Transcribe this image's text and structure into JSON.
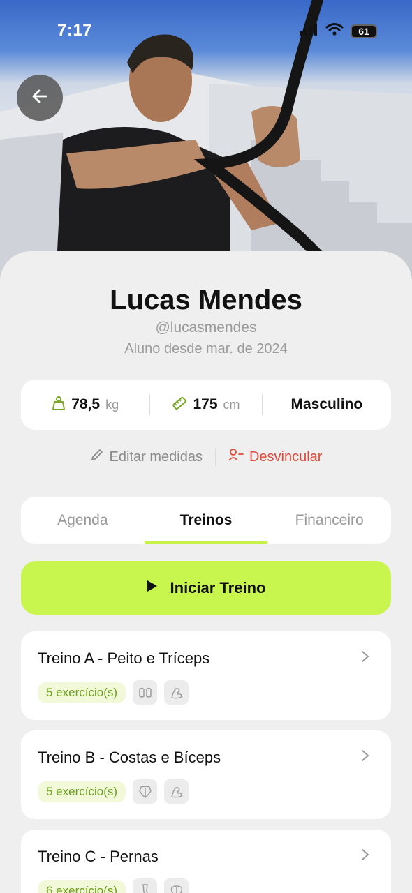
{
  "status_bar": {
    "time": "7:17",
    "battery": "61"
  },
  "profile": {
    "name": "Lucas Mendes",
    "handle": "@lucasmendes",
    "since": "Aluno desde mar. de 2024"
  },
  "stats": {
    "weight_value": "78,5",
    "weight_unit": "kg",
    "height_value": "175",
    "height_unit": "cm",
    "gender": "Masculino"
  },
  "actions": {
    "edit_label": "Editar medidas",
    "unlink_label": "Desvincular"
  },
  "tabs": [
    {
      "label": "Agenda",
      "active": false
    },
    {
      "label": "Treinos",
      "active": true
    },
    {
      "label": "Financeiro",
      "active": false
    }
  ],
  "start_button": {
    "label": "Iniciar Treino"
  },
  "workouts": [
    {
      "title": "Treino A - Peito e Tríceps",
      "count": "5 exercício(s)",
      "icons": [
        "chest-icon",
        "arm-icon"
      ]
    },
    {
      "title": "Treino B - Costas e Bíceps",
      "count": "5 exercício(s)",
      "icons": [
        "back-icon",
        "bicep-icon"
      ]
    },
    {
      "title": "Treino C - Pernas",
      "count": "6 exercício(s)",
      "icons": [
        "leg-icon",
        "glute-icon"
      ]
    }
  ],
  "colors": {
    "accent": "#c8f54e",
    "danger": "#e04a3a",
    "badge_text": "#6a9f1a"
  }
}
